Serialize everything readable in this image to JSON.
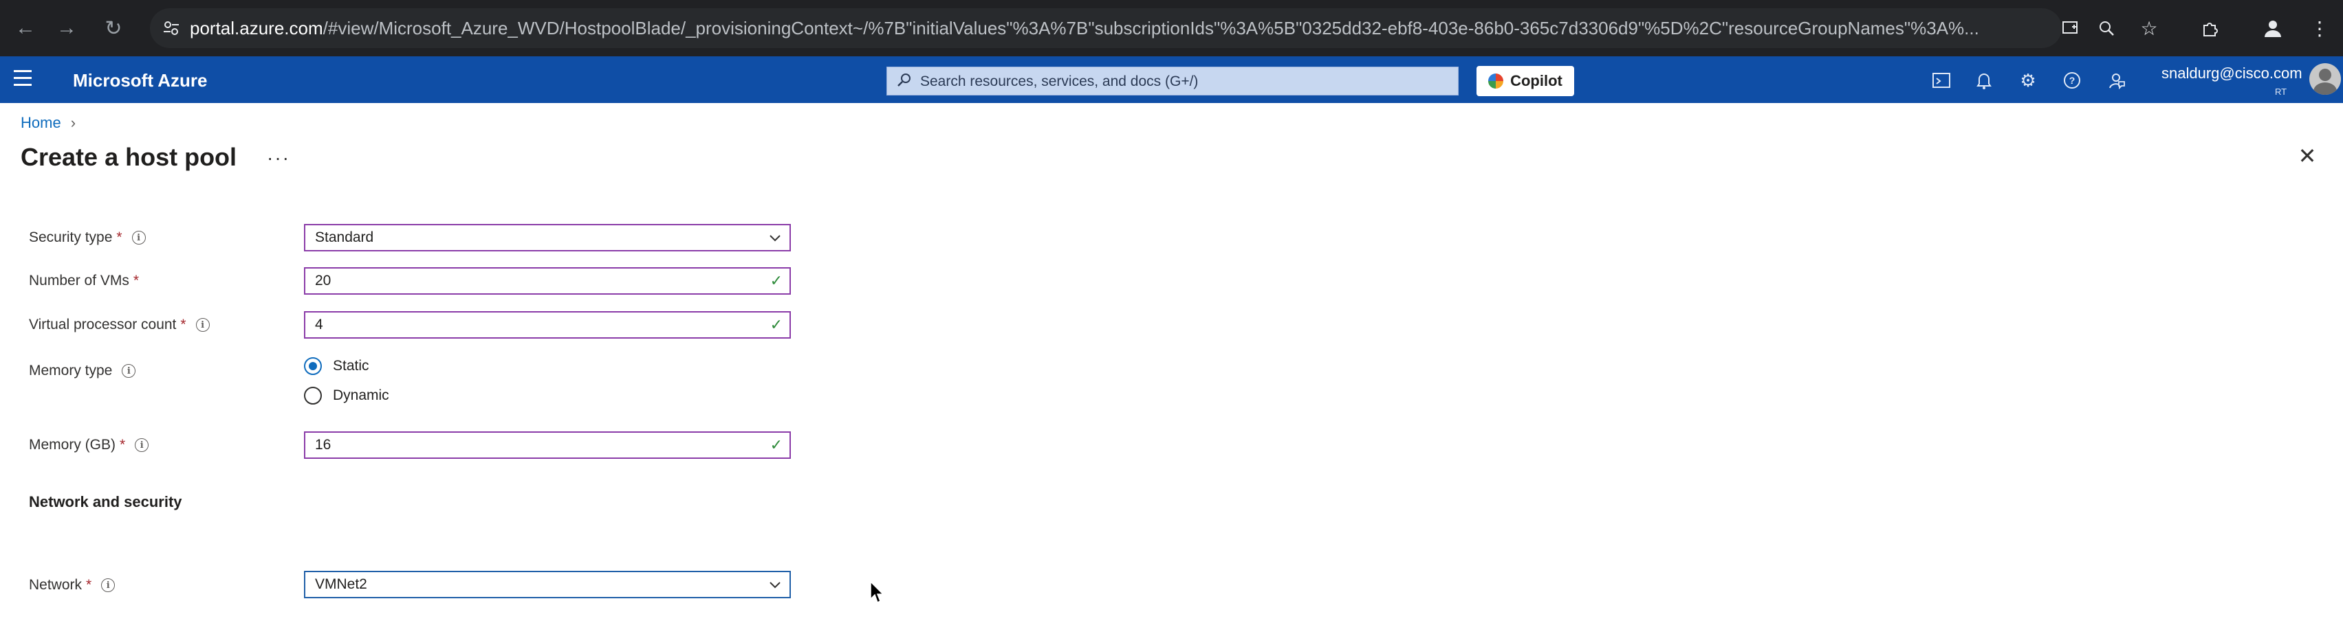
{
  "browser": {
    "url_host": "portal.azure.com",
    "url_rest": "/#view/Microsoft_Azure_WVD/HostpoolBlade/_provisioningContext~/%7B\"initialValues\"%3A%7B\"subscriptionIds\"%3A%5B\"0325dd32-ebf8-403e-86b0-365c7d3306d9\"%5D%2C\"resourceGroupNames\"%3A%..."
  },
  "header": {
    "brand": "Microsoft Azure",
    "search_placeholder": "Search resources, services, and docs (G+/)",
    "copilot_label": "Copilot",
    "user_email": "snaldurg@cisco.com",
    "user_dir": "RT"
  },
  "breadcrumb": {
    "home": "Home"
  },
  "page": {
    "title": "Create a host pool",
    "more": "···",
    "close": "✕"
  },
  "form": {
    "security_type": {
      "label": "Security type",
      "value": "Standard"
    },
    "num_vms": {
      "label": "Number of VMs",
      "value": "20"
    },
    "vcpu_count": {
      "label": "Virtual processor count",
      "value": "4"
    },
    "memory_type": {
      "label": "Memory type",
      "options": [
        "Static",
        "Dynamic"
      ],
      "selected": "Static"
    },
    "memory_gb": {
      "label": "Memory (GB)",
      "value": "16"
    },
    "network_section": "Network and security",
    "network": {
      "label": "Network",
      "value": "VMNet2"
    }
  },
  "colors": {
    "azure_header": "#0f4ea6",
    "required": "#a4262c",
    "valid_check": "#2e8b3a",
    "input_border": "#8a3ba8",
    "link": "#0f6cbd"
  }
}
